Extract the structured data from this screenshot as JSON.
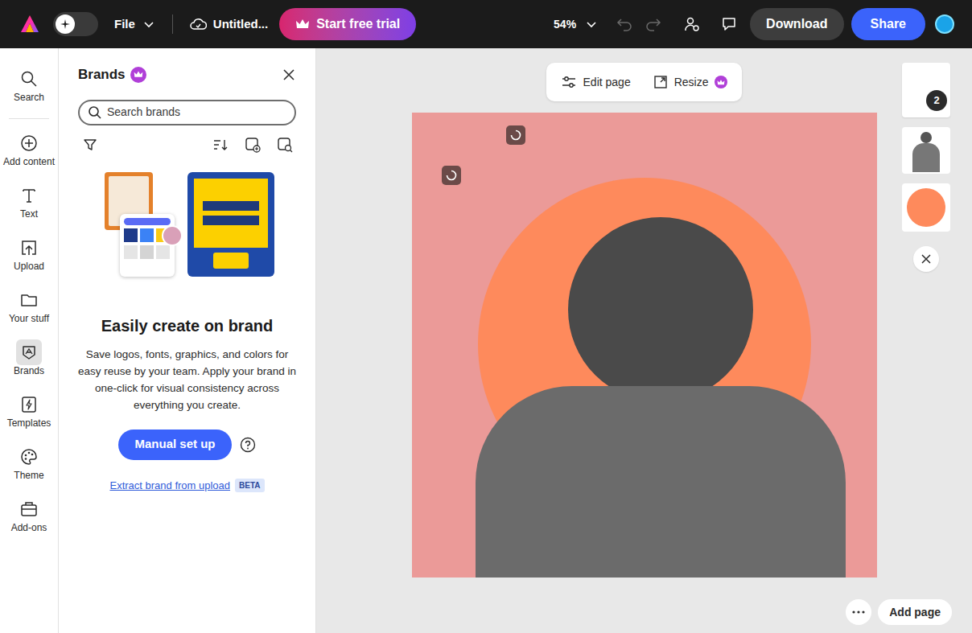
{
  "topbar": {
    "file": "File",
    "title": "Untitled...",
    "trial": "Start free trial",
    "zoom": "54%",
    "undo": {
      "disabled": true
    },
    "redo": {
      "disabled": true
    },
    "download": "Download",
    "share": "Share"
  },
  "rail": [
    {
      "label": "Search",
      "selected": false
    },
    {
      "label": "Add content",
      "selected": false
    },
    {
      "label": "Text",
      "selected": false
    },
    {
      "label": "Upload",
      "selected": false
    },
    {
      "label": "Your stuff",
      "selected": false
    },
    {
      "label": "Brands",
      "selected": true
    },
    {
      "label": "Templates",
      "selected": false
    },
    {
      "label": "Theme",
      "selected": false
    },
    {
      "label": "Add-ons",
      "selected": false
    }
  ],
  "panel": {
    "title": "Brands",
    "search_placeholder": "Search brands",
    "heading": "Easily create on brand",
    "body": "Save logos, fonts, graphics, and colors for easy reuse by your team. Apply your brand in one-click for visual consistency across everything you create.",
    "button": "Manual set up",
    "link": "Extract brand from upload",
    "badge": "BETA"
  },
  "canvas_toolbar": {
    "edit": "Edit page",
    "resize": "Resize"
  },
  "pages": {
    "count": "2"
  },
  "footer": {
    "add_page": "Add page"
  }
}
